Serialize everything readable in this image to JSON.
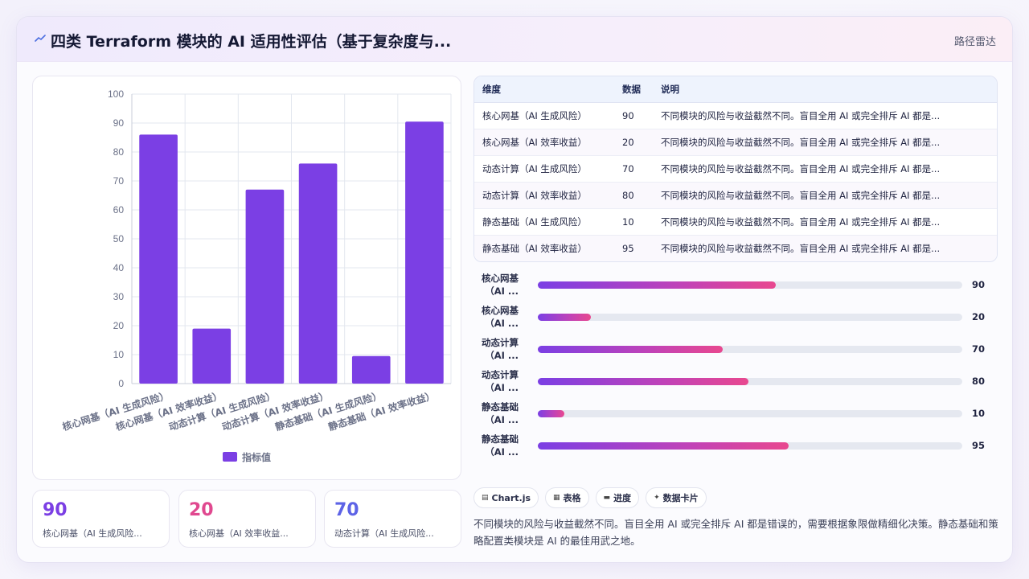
{
  "header": {
    "title": "四类 Terraform 模块的 AI 适用性评估（基于复杂度与...",
    "link": "路径雷达"
  },
  "chart_data": {
    "type": "bar",
    "categories": [
      "核心网基（AI 生成风险）",
      "核心网基（AI 效率收益）",
      "动态计算（AI 生成风险）",
      "动态计算（AI 效率收益）",
      "静态基础（AI 生成风险）",
      "静态基础（AI 效率收益）"
    ],
    "series": [
      {
        "name": "指标值",
        "values": [
          86,
          19,
          67,
          76,
          9.5,
          90.5
        ]
      }
    ],
    "yticks": [
      "0",
      "10",
      "20",
      "30",
      "40",
      "50",
      "60",
      "70",
      "80",
      "90",
      "100"
    ],
    "ylim": [
      0,
      100
    ],
    "grid": true,
    "legend": "bottom",
    "color": "#7b3fe4"
  },
  "stats": [
    {
      "value": "90",
      "label": "核心网基（AI 生成风险...",
      "color": "#7b3fe4"
    },
    {
      "value": "20",
      "label": "核心网基（AI 效率收益...",
      "color": "#e0488f"
    },
    {
      "value": "70",
      "label": "动态计算（AI 生成风险...",
      "color": "#5d63e6"
    }
  ],
  "table": {
    "headers": [
      "维度",
      "数据",
      "说明"
    ],
    "rows": [
      [
        "核心网基（AI 生成风险）",
        "90",
        "不同模块的风险与收益截然不同。盲目全用 AI 或完全排斥 AI 都是..."
      ],
      [
        "核心网基（AI 效率收益）",
        "20",
        "不同模块的风险与收益截然不同。盲目全用 AI 或完全排斥 AI 都是..."
      ],
      [
        "动态计算（AI 生成风险）",
        "70",
        "不同模块的风险与收益截然不同。盲目全用 AI 或完全排斥 AI 都是..."
      ],
      [
        "动态计算（AI 效率收益）",
        "80",
        "不同模块的风险与收益截然不同。盲目全用 AI 或完全排斥 AI 都是..."
      ],
      [
        "静态基础（AI 生成风险）",
        "10",
        "不同模块的风险与收益截然不同。盲目全用 AI 或完全排斥 AI 都是..."
      ],
      [
        "静态基础（AI 效率收益）",
        "95",
        "不同模块的风险与收益截然不同。盲目全用 AI 或完全排斥 AI 都是..."
      ]
    ]
  },
  "progress": [
    {
      "label1": "核心网基",
      "label2": "（AI ...",
      "value": "90",
      "fraction": 0.56
    },
    {
      "label1": "核心网基",
      "label2": "（AI ...",
      "value": "20",
      "fraction": 0.125
    },
    {
      "label1": "动态计算",
      "label2": "（AI ...",
      "value": "70",
      "fraction": 0.435
    },
    {
      "label1": "动态计算",
      "label2": "（AI ...",
      "value": "80",
      "fraction": 0.497
    },
    {
      "label1": "静态基础",
      "label2": "（AI ...",
      "value": "10",
      "fraction": 0.062
    },
    {
      "label1": "静态基础",
      "label2": "（AI ...",
      "value": "95",
      "fraction": 0.59
    }
  ],
  "chips": [
    {
      "icon": "▤",
      "label": "Chart.js"
    },
    {
      "icon": "▦",
      "label": "表格"
    },
    {
      "icon": "▬",
      "label": "进度"
    },
    {
      "icon": "✦",
      "label": "数据卡片"
    }
  ],
  "summary": "不同模块的风险与收益截然不同。盲目全用 AI 或完全排斥 AI 都是错误的，需要根据象限做精细化决策。静态基础和策略配置类模块是 AI 的最佳用武之地。"
}
